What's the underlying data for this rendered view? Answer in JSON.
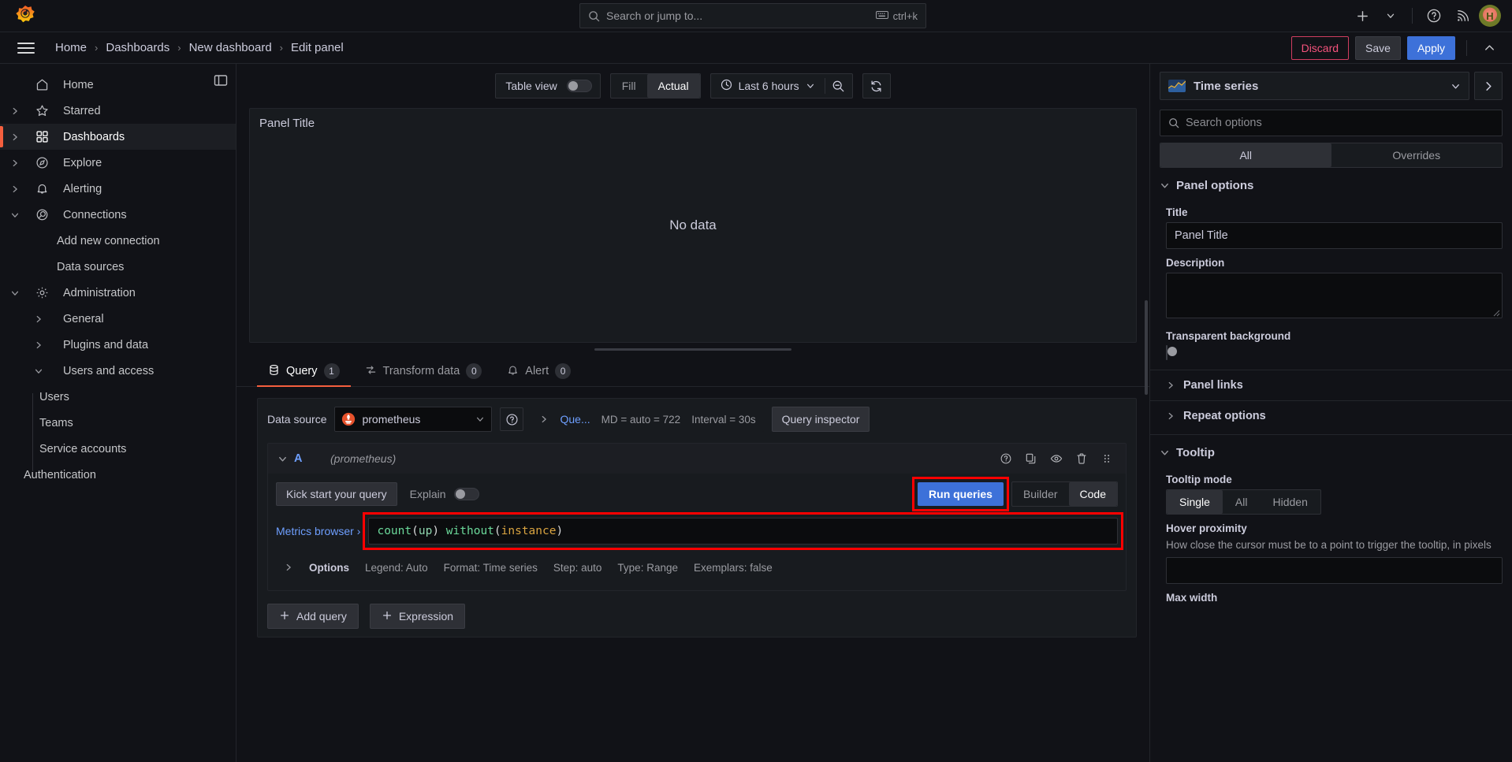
{
  "topbar": {
    "logo_icon": "grafana-logo-icon",
    "search": {
      "placeholder": "Search or jump to...",
      "shortcut": "ctrl+k",
      "icon": "search-icon",
      "kbd_icon": "keyboard-icon"
    },
    "plus_icon": "plus-icon",
    "plus_caret_icon": "chevron-down-icon",
    "help_icon": "help-circle-icon",
    "news_icon": "rss-icon",
    "avatar_initial": "H"
  },
  "breadcrumb": {
    "menu_icon": "hamburger-menu-icon",
    "items": [
      {
        "label": "Home"
      },
      {
        "label": "Dashboards"
      },
      {
        "label": "New dashboard"
      },
      {
        "label": "Edit panel"
      }
    ],
    "separator": "›",
    "discard_label": "Discard",
    "save_label": "Save",
    "apply_label": "Apply",
    "collapse_icon": "chevron-up-icon",
    "colors": {
      "discard": "#f5537c",
      "apply": "#3d71d9",
      "accent": "#f55f3e"
    }
  },
  "sidebar": {
    "dock_icon": "dock-panel-icon",
    "items": [
      {
        "label": "Home",
        "icon": "home-icon",
        "level": 1,
        "chevron": "",
        "active": false
      },
      {
        "label": "Starred",
        "icon": "star-icon",
        "level": 1,
        "chevron": "right",
        "active": false
      },
      {
        "label": "Dashboards",
        "icon": "dashboards-grid-icon",
        "level": 1,
        "chevron": "right",
        "active": true
      },
      {
        "label": "Explore",
        "icon": "compass-icon",
        "level": 1,
        "chevron": "right",
        "active": false
      },
      {
        "label": "Alerting",
        "icon": "bell-icon",
        "level": 1,
        "chevron": "right",
        "active": false
      },
      {
        "label": "Connections",
        "icon": "connections-icon",
        "level": 1,
        "chevron": "down",
        "active": false
      },
      {
        "label": "Add new connection",
        "icon": "",
        "level": 2,
        "chevron": "",
        "active": false
      },
      {
        "label": "Data sources",
        "icon": "",
        "level": 2,
        "chevron": "",
        "active": false
      },
      {
        "label": "Administration",
        "icon": "gear-icon",
        "level": 1,
        "chevron": "down",
        "active": false
      },
      {
        "label": "General",
        "icon": "",
        "level": 2,
        "chevron": "right",
        "active": false
      },
      {
        "label": "Plugins and data",
        "icon": "",
        "level": 2,
        "chevron": "right",
        "active": false
      },
      {
        "label": "Users and access",
        "icon": "",
        "level": 2,
        "chevron": "down",
        "active": false
      },
      {
        "label": "Users",
        "icon": "",
        "level": 3,
        "chevron": "",
        "active": false
      },
      {
        "label": "Teams",
        "icon": "",
        "level": 3,
        "chevron": "",
        "active": false
      },
      {
        "label": "Service accounts",
        "icon": "",
        "level": 3,
        "chevron": "",
        "active": false
      },
      {
        "label": "Authentication",
        "icon": "",
        "level": 2,
        "chevron": "",
        "active": false
      }
    ]
  },
  "panel_toolbar": {
    "table_view_label": "Table view",
    "table_view_on": false,
    "fill_label": "Fill",
    "actual_label": "Actual",
    "fill_actual_selected": "Actual",
    "time_range": "Last 6 hours",
    "time_icon": "clock-icon",
    "time_caret_icon": "chevron-down-icon",
    "zoom_out_icon": "zoom-out-icon",
    "refresh_icon": "refresh-icon"
  },
  "panel": {
    "title": "Panel Title",
    "no_data_text": "No data"
  },
  "tabs": [
    {
      "label": "Query",
      "badge": "1",
      "icon": "database-icon",
      "active": true
    },
    {
      "label": "Transform data",
      "badge": "0",
      "icon": "transform-icon",
      "active": false
    },
    {
      "label": "Alert",
      "badge": "0",
      "icon": "bell-icon",
      "active": false
    }
  ],
  "query_editor": {
    "data_source_label": "Data source",
    "data_source_name": "prometheus",
    "data_source_icon": "prometheus-logo-icon",
    "ds_caret_icon": "chevron-down-icon",
    "help_icon": "help-circle-icon",
    "options_caret_icon": "chevron-right-icon",
    "options_link": "Que...",
    "max_data_points": "MD = auto = 722",
    "interval": "Interval = 30s",
    "query_inspector_label": "Query inspector",
    "row": {
      "caret_icon": "chevron-down-icon",
      "ref_id": "A",
      "datasource_note": "(prometheus)",
      "icons": [
        "help-circle-icon",
        "duplicate-icon",
        "eye-icon",
        "trash-icon",
        "drag-handle-icon"
      ],
      "kick_start_label": "Kick start your query",
      "explain_label": "Explain",
      "explain_on": false,
      "run_queries_label": "Run queries",
      "builder_label": "Builder",
      "code_label": "Code",
      "mode_selected": "Code",
      "metrics_browser_label": "Metrics browser",
      "metrics_browser_caret": "›",
      "expression": "count(up) without(instance)",
      "expression_tokens": [
        {
          "t": "count",
          "k": "fn"
        },
        {
          "t": "(",
          "k": "paren"
        },
        {
          "t": "up",
          "k": "ident"
        },
        {
          "t": ")",
          "k": "paren"
        },
        {
          "t": " ",
          "k": "plain"
        },
        {
          "t": "without",
          "k": "fn"
        },
        {
          "t": "(",
          "k": "paren"
        },
        {
          "t": "instance",
          "k": "arg"
        },
        {
          "t": ")",
          "k": "paren"
        }
      ],
      "options_caret_icon": "chevron-right-icon",
      "options_label": "Options",
      "options_values": [
        "Legend: Auto",
        "Format: Time series",
        "Step: auto",
        "Type: Range",
        "Exemplars: false"
      ]
    },
    "add_query_label": "Add query",
    "add_expression_label": "Expression",
    "add_icon": "plus-icon"
  },
  "options_pane": {
    "viz_name": "Time series",
    "viz_icon": "time-series-thumb-icon",
    "viz_caret_icon": "chevron-down-icon",
    "viz_expand_icon": "chevron-right-icon",
    "search_placeholder": "Search options",
    "search_icon": "search-icon",
    "tab_all": "All",
    "tab_overrides": "Overrides",
    "tab_selected": "All",
    "panel_options_title": "Panel options",
    "title_label": "Title",
    "title_value": "Panel Title",
    "description_label": "Description",
    "description_value": "",
    "transparent_label": "Transparent background",
    "transparent_on": false,
    "panel_links_label": "Panel links",
    "repeat_options_label": "Repeat options",
    "tooltip_title": "Tooltip",
    "tooltip_mode_label": "Tooltip mode",
    "tooltip_modes": [
      "Single",
      "All",
      "Hidden"
    ],
    "tooltip_mode_selected": "Single",
    "hover_proximity_label": "Hover proximity",
    "hover_proximity_desc": "How close the cursor must be to a point to trigger the tooltip, in pixels",
    "hover_proximity_value": "",
    "max_width_label": "Max width"
  }
}
